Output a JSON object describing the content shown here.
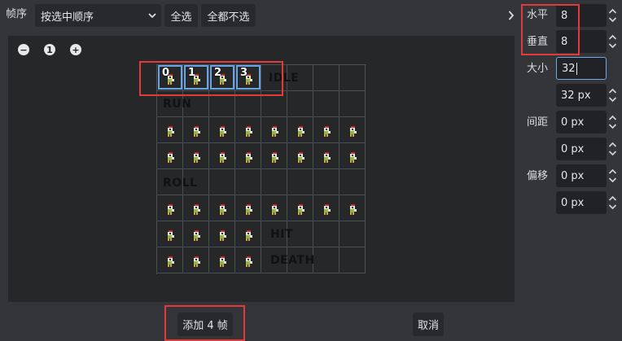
{
  "toolbar": {
    "frame_order_label": "帧序",
    "frame_order_value": "按选中顺序",
    "select_all": "全选",
    "deselect_all": "全都不选"
  },
  "zoom": {
    "out": "−",
    "reset": "1",
    "in": "+"
  },
  "sheet": {
    "frame_numbers": [
      "0",
      "1",
      "2",
      "3"
    ],
    "labels": {
      "idle": "IDLE",
      "run": "RUN",
      "roll": "ROLL",
      "hit": "HIT",
      "death": "DEATH"
    }
  },
  "settings": {
    "horizontal_label": "水平",
    "horizontal_value": "8",
    "vertical_label": "垂直",
    "vertical_value": "8",
    "size_label": "大小",
    "size_x_value": "32",
    "size_y_value": "32 px",
    "separation_label": "间距",
    "separation_x_value": "0 px",
    "separation_y_value": "0 px",
    "offset_label": "偏移",
    "offset_x_value": "0 px",
    "offset_y_value": "0 px"
  },
  "footer": {
    "add_frames": "添加 4 帧",
    "cancel": "取消"
  },
  "colors": {
    "highlight": "#e23a3a",
    "selection": "#6aa3e6",
    "focus": "#6fa7e8"
  }
}
